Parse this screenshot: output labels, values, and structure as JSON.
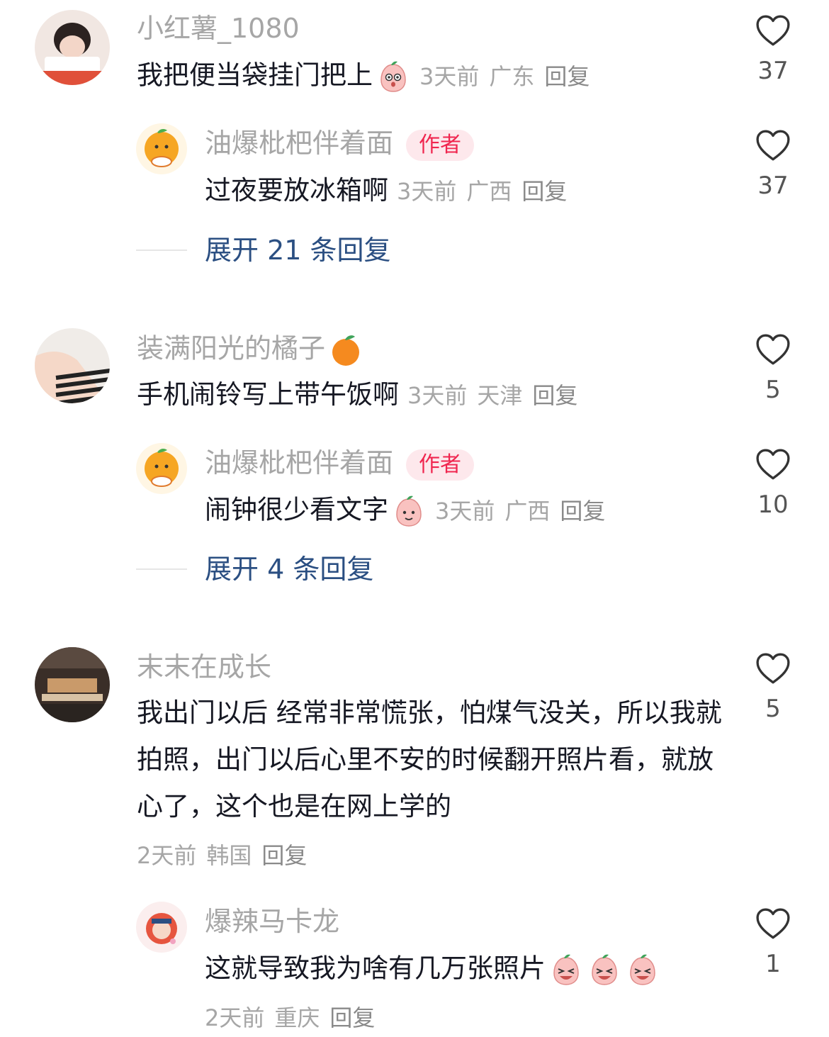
{
  "threads": [
    {
      "username": "小红薯_1080",
      "text": "我把便当袋挂门把上",
      "time": "3天前",
      "location": "广东",
      "reply_label": "回复",
      "likes": "37",
      "author_reply": {
        "username": "油爆枇杷伴着面",
        "badge": "作者",
        "text": "过夜要放冰箱啊",
        "time": "3天前",
        "location": "广西",
        "reply_label": "回复",
        "likes": "37"
      },
      "expand_label": "展开 21 条回复"
    },
    {
      "username": "装满阳光的橘子",
      "text": "手机闹铃写上带午饭啊",
      "time": "3天前",
      "location": "天津",
      "reply_label": "回复",
      "likes": "5",
      "author_reply": {
        "username": "油爆枇杷伴着面",
        "badge": "作者",
        "text": "闹钟很少看文字",
        "time": "3天前",
        "location": "广西",
        "reply_label": "回复",
        "likes": "10"
      },
      "expand_label": "展开 4 条回复"
    },
    {
      "username": "末末在成长",
      "text": "我出门以后 经常非常慌张，怕煤气没关，所以我就拍照，出门以后心里不安的时候翻开照片看，就放心了，这个也是在网上学的",
      "time": "2天前",
      "location": "韩国",
      "reply_label": "回复",
      "likes": "5",
      "reply": {
        "username": "爆辣马卡龙",
        "text": "这就导致我为啥有几万张照片",
        "time": "2天前",
        "location": "重庆",
        "reply_label": "回复",
        "likes": "1"
      }
    }
  ],
  "icons": {
    "like": "heart-outline-icon"
  },
  "colors": {
    "accent_link": "#2b4f82",
    "author_badge": "#f0264f",
    "muted": "#a6a6a6"
  }
}
